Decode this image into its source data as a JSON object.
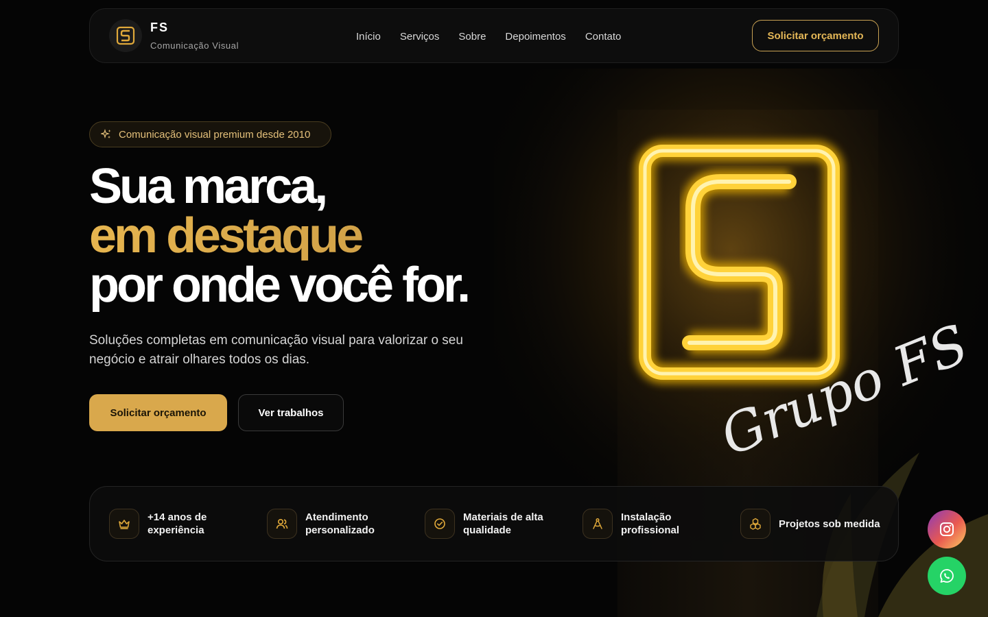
{
  "brand": {
    "name": "FS",
    "subtitle": "Comunicação Visual"
  },
  "nav": {
    "links": [
      "Início",
      "Serviços",
      "Sobre",
      "Depoimentos",
      "Contato"
    ],
    "cta_label": "Solicitar orçamento"
  },
  "hero": {
    "badge": "Comunicação visual premium desde 2010",
    "headline_line1": "Sua marca,",
    "headline_line2": "em destaque",
    "headline_line3": "por onde você for.",
    "description": "Soluções completas em comunicação visual para valorizar o seu negócio e atrair olhares todos os dias.",
    "primary_button": "Solicitar orçamento",
    "secondary_button": "Ver trabalhos",
    "sign_script": "Grupo FS"
  },
  "features": [
    {
      "label": "+14 anos de experiência",
      "icon": "crown-icon"
    },
    {
      "label": "Atendimento personalizado",
      "icon": "users-icon"
    },
    {
      "label": "Materiais de alta qualidade",
      "icon": "badge-check-icon"
    },
    {
      "label": "Instalação profissional",
      "icon": "compass-icon"
    },
    {
      "label": "Projetos sob medida",
      "icon": "cubes-icon"
    }
  ],
  "social": {
    "instagram_icon": "instagram-icon",
    "whatsapp_icon": "whatsapp-icon"
  },
  "colors": {
    "accent": "#d9a84c",
    "gold_text": "#e4b757",
    "background": "#050505",
    "whatsapp": "#25d366"
  }
}
